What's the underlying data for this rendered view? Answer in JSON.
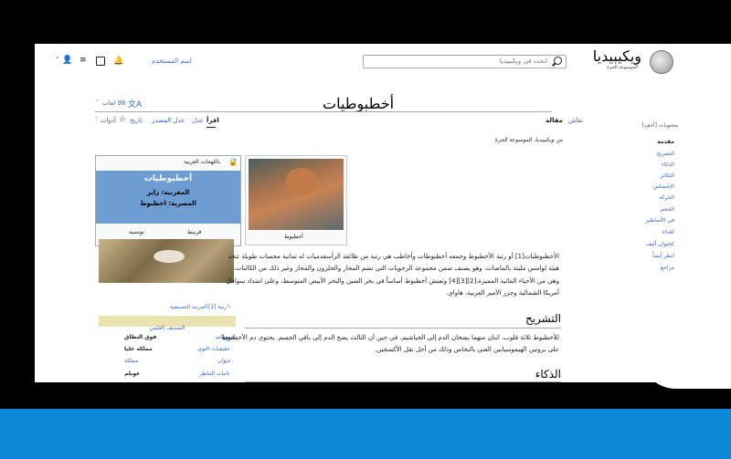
{
  "header": {
    "logo_text": "ويكيبيديا",
    "logo_sub": "الموسوعة الحرة",
    "search_placeholder": "ابحث في ويكيبيديا",
    "username": "اسم المستخدم"
  },
  "article": {
    "title": "أخطبوطيات",
    "languages": "98 لغات",
    "tabs_right": [
      "مقالة",
      "نقاش"
    ],
    "tabs_left": [
      "اقرأ",
      "عدل",
      "عدل المصدر",
      "تاريخ",
      "أدوات"
    ],
    "from": "من ويكيبيديا، الموسوعة الحرة",
    "lead_lines": [
      "الأخطبوطيات[1] أو رتبة الأخطبوط وجمعه أخطبوطات وأخاطب هي رتبة من طائفة الرأسقدميات له ثمانية مجسات طويلة تتخذ",
      "هيئة لوامس مليئة بالماصات، وهو يصنف ضمن مجموعة الرخويات التي تضم المحار والحلزون والمحار وغير ذلك من الكائنات.",
      "وهي من الأحياء المائية المميزة،[2][3][4] وتعيش أخطبوط أساساً في بحر الصين والبحر الأبيض المتوسط، وعلى امتداد سواحل",
      "أمريكا الشمالية وجزر الأمير العربية، هاواي."
    ],
    "section1_title": "التشريح",
    "section1_lines": [
      "للأخطبوط ثلاثة قلوب، اثنان منهما يضخان الدم إلى الخياشيم، في حين أن الثالث يضخ الدم إلى باقي الجسم. يحتوي دم الأخطبوط",
      "على بروتين الهيموسيانين الغني بالنحاس وذلك من أجل نقل الأكسجين."
    ],
    "section2_title": "الذكاء"
  },
  "toc": {
    "heading": "محتويات [أخفِ]",
    "items": [
      "مقدمة",
      "التشريح",
      "الذكاء",
      "التكاثر",
      "الإحساس",
      "الحركة",
      "الحجم",
      "في الأساطير",
      "كغذاء",
      "كحيوان أليف",
      "انظر أيضاً",
      "مراجع"
    ]
  },
  "infobox": {
    "top_label": "باللهجات العربية",
    "head_title": "أخطبوطيات",
    "line1": "المغربية: زايز",
    "line2": "المصرية: اخطبوط",
    "col1": "تونسية",
    "col2": "قرنيط"
  },
  "thumb": {
    "caption": "أخطبوط"
  },
  "taxonomy": {
    "rank_link": "المرتبة التصنيفية",
    "rank_value": "رتبة [1]",
    "classification": "التصنيف العلمي",
    "rows": [
      [
        "فوق النطاق",
        "حيويات"
      ],
      [
        "مملكة عليا",
        "حقيقيات النوى"
      ],
      [
        "مملكة",
        "حيوان"
      ],
      [
        "عويلم",
        "ثانيات التناظر"
      ]
    ]
  }
}
